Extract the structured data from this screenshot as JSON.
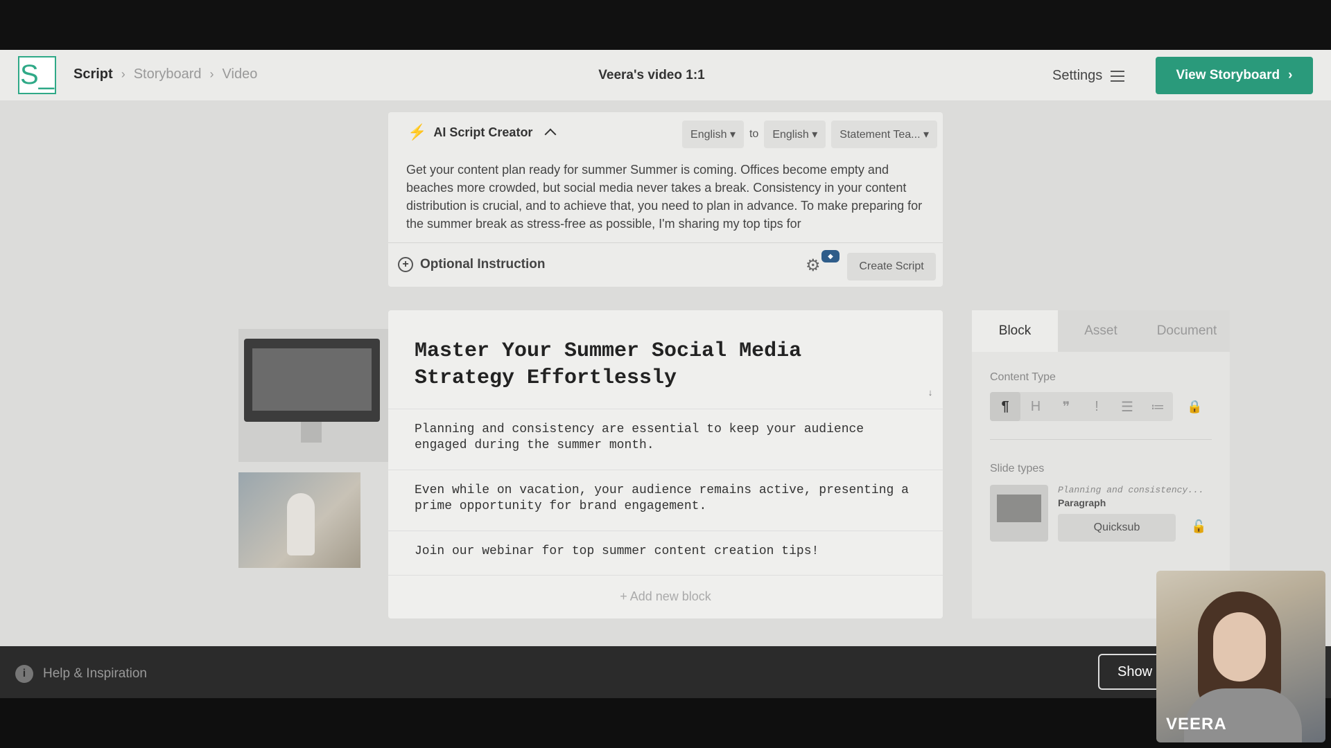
{
  "header": {
    "logo_letter": "S_",
    "breadcrumbs": [
      "Script",
      "Storyboard",
      "Video"
    ],
    "doc_title": "Veera's video 1:1",
    "settings_label": "Settings",
    "view_storyboard_label": "View Storyboard"
  },
  "ai_creator": {
    "title": "AI Script Creator",
    "from_lang": "English",
    "to_label": "to",
    "to_lang": "English",
    "template": "Statement Tea...",
    "source_text": "Get your content plan ready for summer Summer is coming. Offices become empty and beaches more crowded, but social media never takes a break. Consistency in your content distribution is crucial, and to achieve that, you need to plan in advance. To make preparing for the summer break as stress-free as possible, I'm sharing my top tips for",
    "optional_instruction_label": "Optional Instruction",
    "create_script_label": "Create Script"
  },
  "editor": {
    "title": "Master Your Summer Social Media Strategy Effortlessly",
    "blocks": [
      "Planning and consistency are essential to keep your audience engaged during the summer month.",
      "Even while on vacation, your audience remains active, presenting a prime opportunity for brand engagement.",
      "Join our webinar for top summer content creation tips!"
    ],
    "add_block_label": "+ Add new block"
  },
  "side_panel": {
    "tabs": [
      "Block",
      "Asset",
      "Document"
    ],
    "content_type_label": "Content Type",
    "slide_types_label": "Slide types",
    "slide_preview_text": "Planning and consistency...",
    "slide_kind": "Paragraph",
    "quicksub_label": "Quicksub"
  },
  "footer": {
    "help_label": "Help & Inspiration",
    "show_label": "Show"
  },
  "webcam": {
    "name": "VEERA"
  }
}
